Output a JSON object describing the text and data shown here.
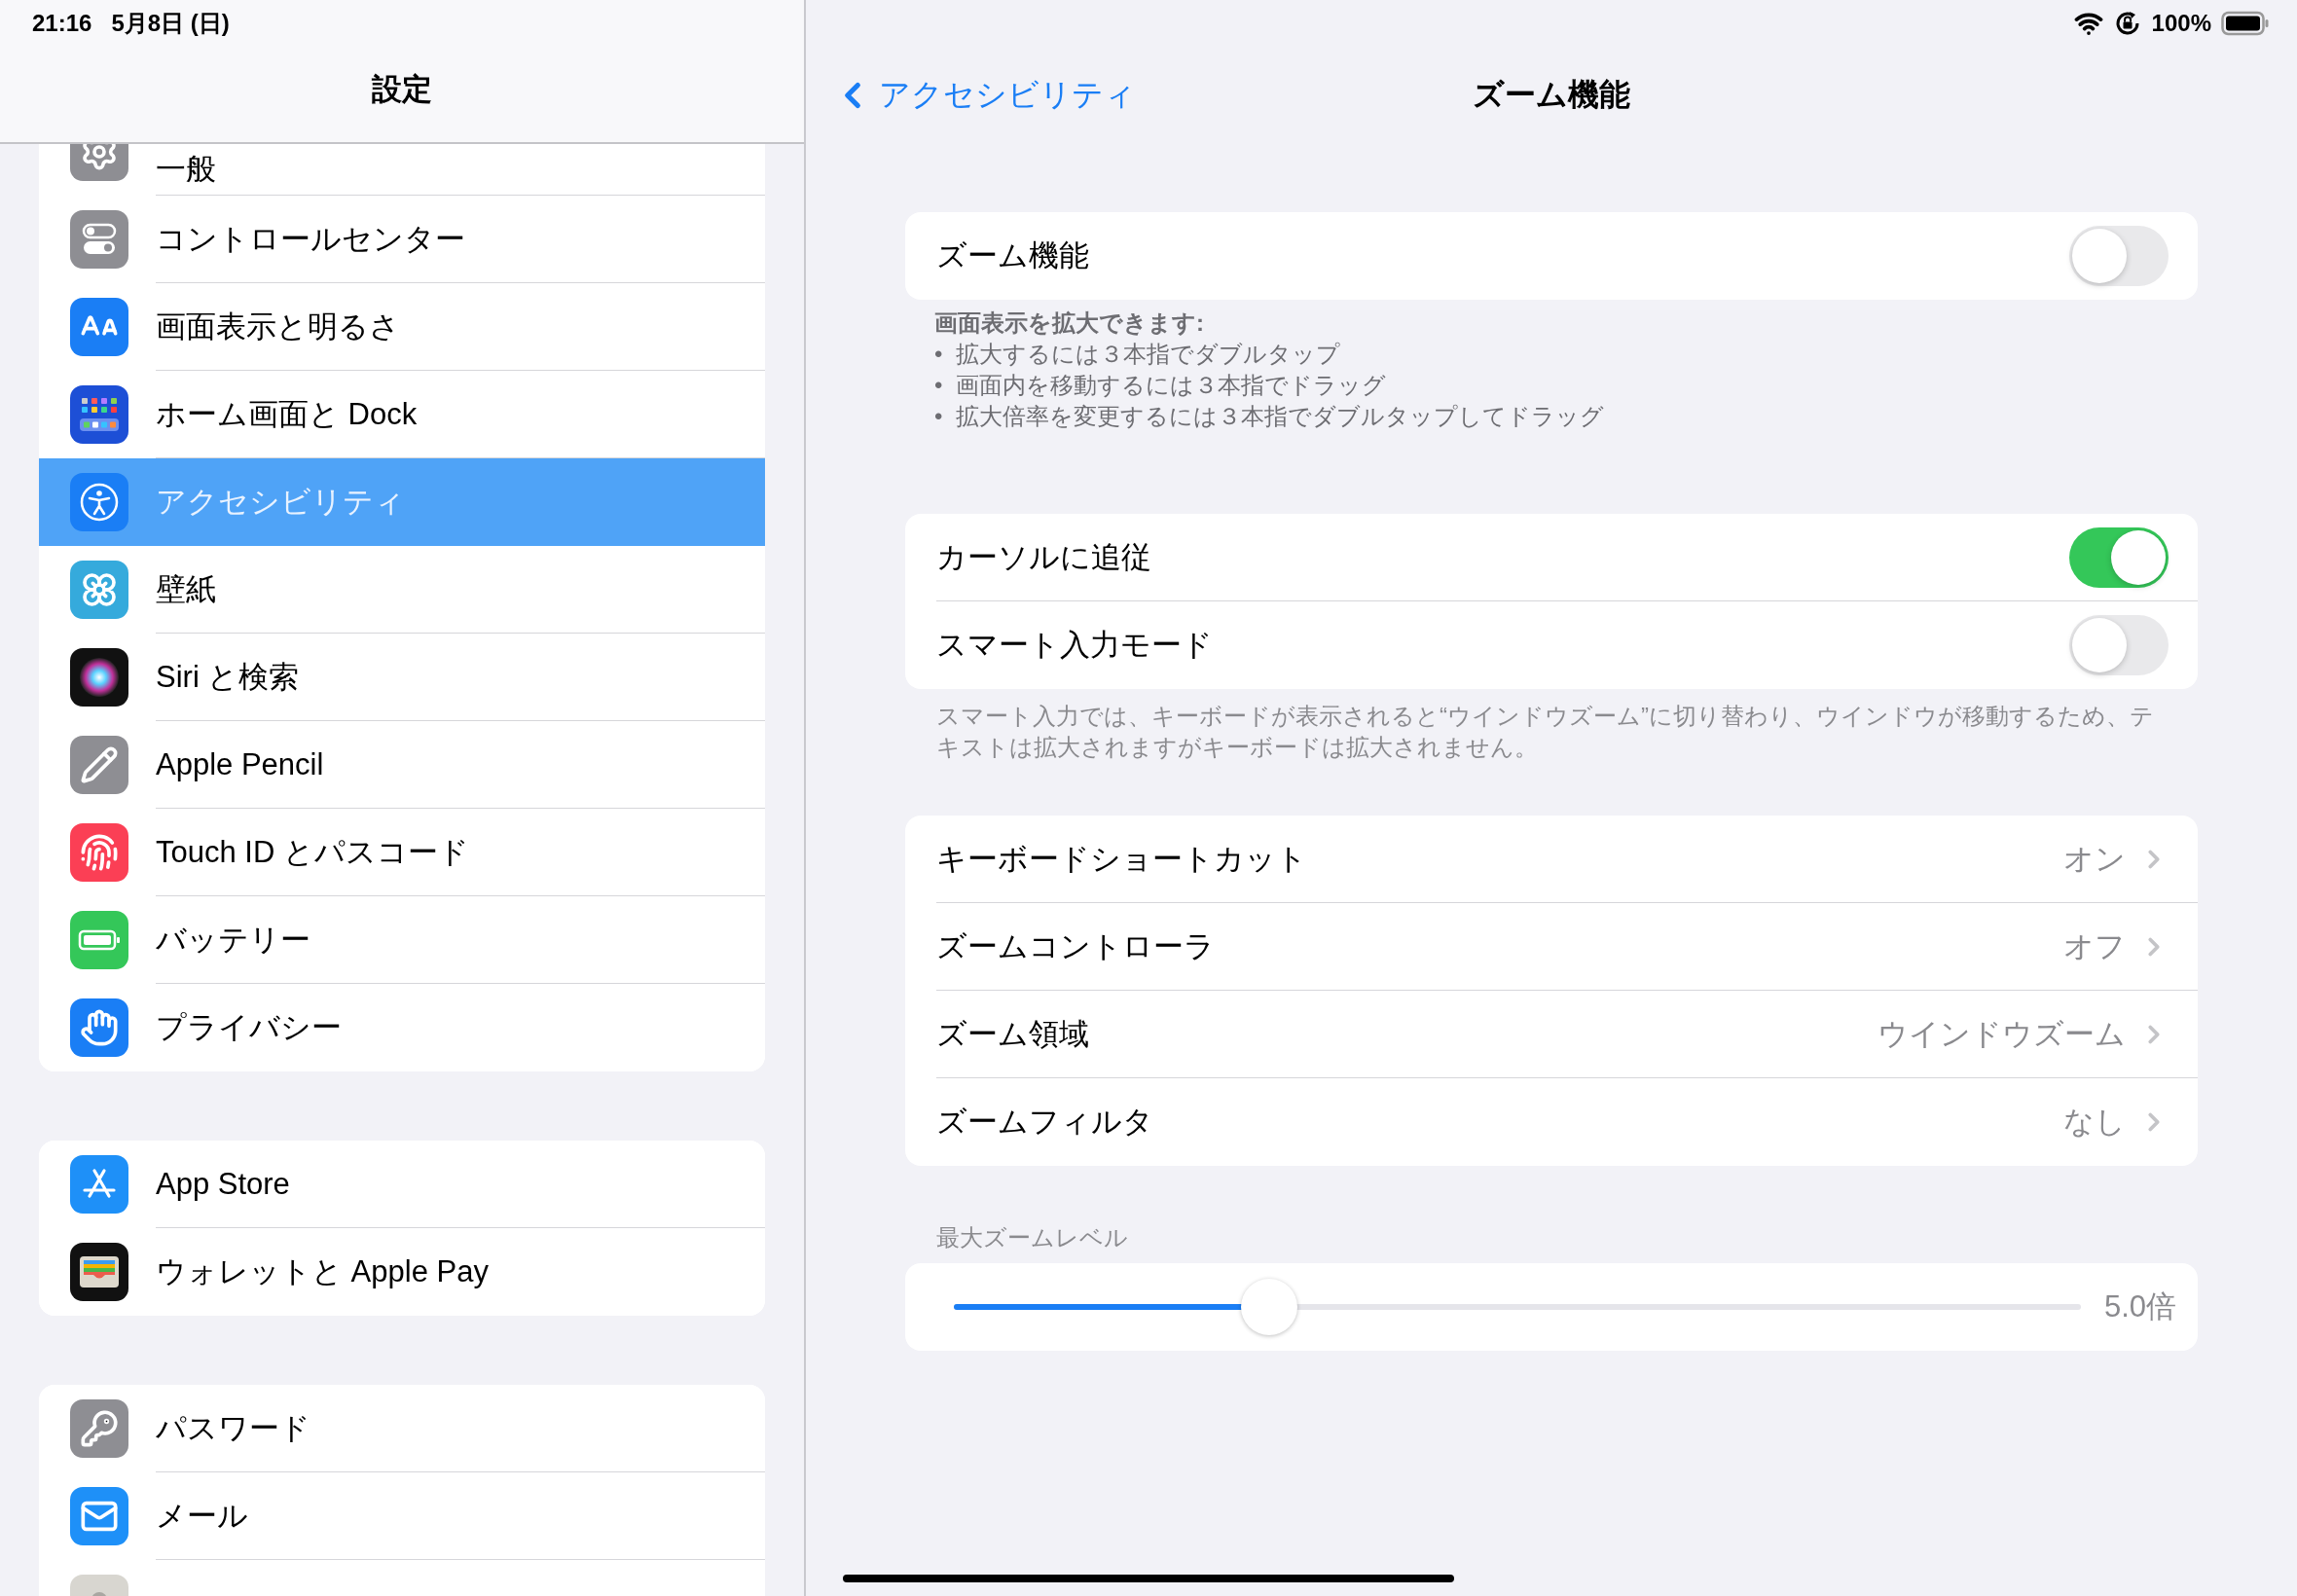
{
  "status_bar": {
    "time": "21:16",
    "date": "5月8日 (日)",
    "battery": "100%"
  },
  "sidebar": {
    "title": "設定",
    "groups": [
      {
        "items": [
          {
            "label": "一般",
            "selected": false
          },
          {
            "label": "コントロールセンター",
            "selected": false
          },
          {
            "label": "画面表示と明るさ",
            "selected": false
          },
          {
            "label": "ホーム画面と Dock",
            "selected": false
          },
          {
            "label": "アクセシビリティ",
            "selected": true
          },
          {
            "label": "壁紙",
            "selected": false
          },
          {
            "label": "Siri と検索",
            "selected": false
          },
          {
            "label": "Apple Pencil",
            "selected": false
          },
          {
            "label": "Touch ID とパスコード",
            "selected": false
          },
          {
            "label": "バッテリー",
            "selected": false
          },
          {
            "label": "プライバシー",
            "selected": false
          }
        ]
      },
      {
        "items": [
          {
            "label": "App Store",
            "selected": false
          },
          {
            "label": "ウォレットと Apple Pay",
            "selected": false
          }
        ]
      },
      {
        "items": [
          {
            "label": "パスワード",
            "selected": false
          },
          {
            "label": "メール",
            "selected": false
          },
          {
            "selected": false
          }
        ]
      }
    ]
  },
  "nav": {
    "back": "アクセシビリティ",
    "title": "ズーム機能"
  },
  "sections": [
    {
      "rows": [
        {
          "kind": "toggle",
          "label": "ズーム機能",
          "on": false
        }
      ],
      "footer_title": "画面表示を拡大できます:",
      "footer_bullets": [
        {
          "mark": "•",
          "text": "拡大するには３本指でダブルタップ"
        },
        {
          "mark": "•",
          "text": "画面内を移動するには３本指でドラッグ"
        },
        {
          "mark": "•",
          "text": "拡大倍率を変更するには３本指でダブルタップしてドラッグ"
        }
      ]
    },
    {
      "rows": [
        {
          "kind": "toggle",
          "label": "カーソルに追従",
          "on": true
        },
        {
          "kind": "toggle",
          "label": "スマート入力モード",
          "on": false
        }
      ],
      "footer": "スマート入力では、キーボードが表示されると“ウインドウズーム”に切り替わり、ウインドウが移動するため、テキストは拡大されますがキーボードは拡大されません。"
    },
    {
      "rows": [
        {
          "kind": "link",
          "label": "キーボードショートカット",
          "value": "オン"
        },
        {
          "kind": "link",
          "label": "ズームコントローラ",
          "value": "オフ"
        },
        {
          "kind": "link",
          "label": "ズーム領域",
          "value": "ウインドウズーム"
        },
        {
          "kind": "link",
          "label": "ズームフィルタ",
          "value": "なし"
        }
      ]
    },
    {
      "header": "最大ズームレベル",
      "rows": [
        {
          "kind": "slider",
          "level": 0.28,
          "value": "5.0倍"
        }
      ]
    }
  ]
}
